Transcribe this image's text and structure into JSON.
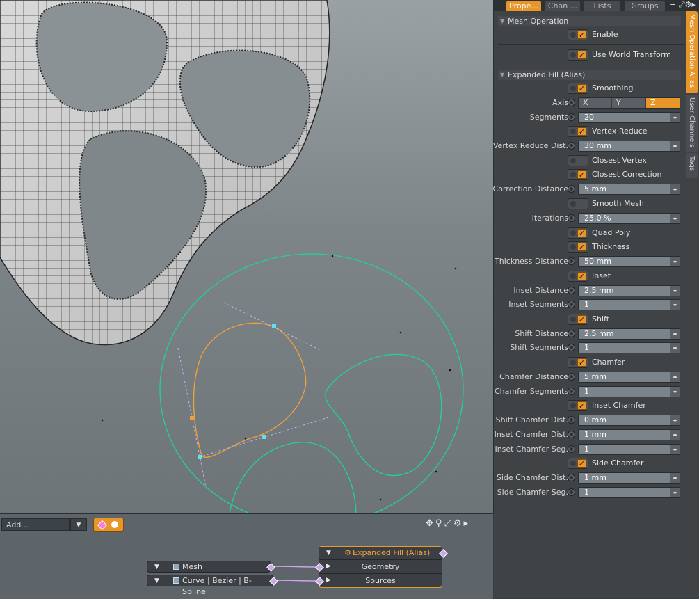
{
  "panel": {
    "tabs": [
      {
        "label": "Prope..."
      },
      {
        "label": "Chan ..."
      },
      {
        "label": "Lists"
      },
      {
        "label": "Groups"
      }
    ],
    "tab_extra": "+",
    "side_tabs": [
      "Mesh Operation Alias",
      "User Channels",
      "Tags"
    ],
    "sections": {
      "mesh_operation": "Mesh Operation",
      "expanded_fill": "Expanded Fill (Alias)"
    },
    "mesh_op": {
      "enable": "Enable",
      "world": "Use World Transform"
    },
    "props": {
      "smoothing": "Smoothing",
      "axis_label": "Axis",
      "axis_x": "X",
      "axis_y": "Y",
      "axis_z": "Z",
      "segments_label": "Segments",
      "segments_value": "20",
      "vertex_reduce": "Vertex Reduce",
      "vrd_label": "Vertex Reduce Dist.",
      "vrd_value": "30 mm",
      "closest_vertex": "Closest Vertex",
      "closest_correction": "Closest Correction",
      "corr_label": "Correction Distance",
      "corr_value": "5 mm",
      "smooth_mesh": "Smooth Mesh",
      "iter_label": "Iterations",
      "iter_value": "25.0 %",
      "quad_poly": "Quad Poly",
      "thickness": "Thickness",
      "thick_label": "Thickness Distance",
      "thick_value": "50 mm",
      "inset": "Inset",
      "inset_dist_label": "Inset Distance",
      "inset_dist_value": "2.5 mm",
      "inset_seg_label": "Inset Segments",
      "inset_seg_value": "1",
      "shift": "Shift",
      "shift_dist_label": "Shift Distance",
      "shift_dist_value": "2.5 mm",
      "shift_seg_label": "Shift Segments",
      "shift_seg_value": "1",
      "chamfer": "Chamfer",
      "cham_dist_label": "Chamfer Distance",
      "cham_dist_value": "5 mm",
      "cham_seg_label": "Chamfer Segments",
      "cham_seg_value": "1",
      "inset_chamfer": "Inset Chamfer",
      "scd_label": "Shift Chamfer Dist.",
      "scd_value": "0 mm",
      "icd_label": "Inset Chamfer Dist.",
      "icd_value": "1 mm",
      "ics_label": "Inset Chamfer Seg.",
      "ics_value": "1",
      "side_chamfer": "Side Chamfer",
      "sidecd_label": "Side Chamfer Dist.",
      "sidecd_value": "1 mm",
      "sidecs_label": "Side Chamfer Seg.",
      "sidecs_value": "1"
    }
  },
  "schematic": {
    "add_placeholder": "Add...",
    "nodes": {
      "mesh": "Mesh",
      "curve": "Curve | Bezier | B-Spline",
      "expanded_fill": "Expanded Fill (Alias)",
      "geometry": "Geometry",
      "sources": "Sources"
    }
  },
  "colors": {
    "accent": "#e8952a",
    "curve_green": "#1fd39a",
    "curve_orange": "#f0a03a",
    "handle_cyan": "#5de0f0"
  },
  "icons": [
    "check-icon",
    "spinner-icon",
    "gear-icon",
    "search-icon",
    "move-icon",
    "expand-icon",
    "triangle-down-icon",
    "triangle-right-icon"
  ]
}
